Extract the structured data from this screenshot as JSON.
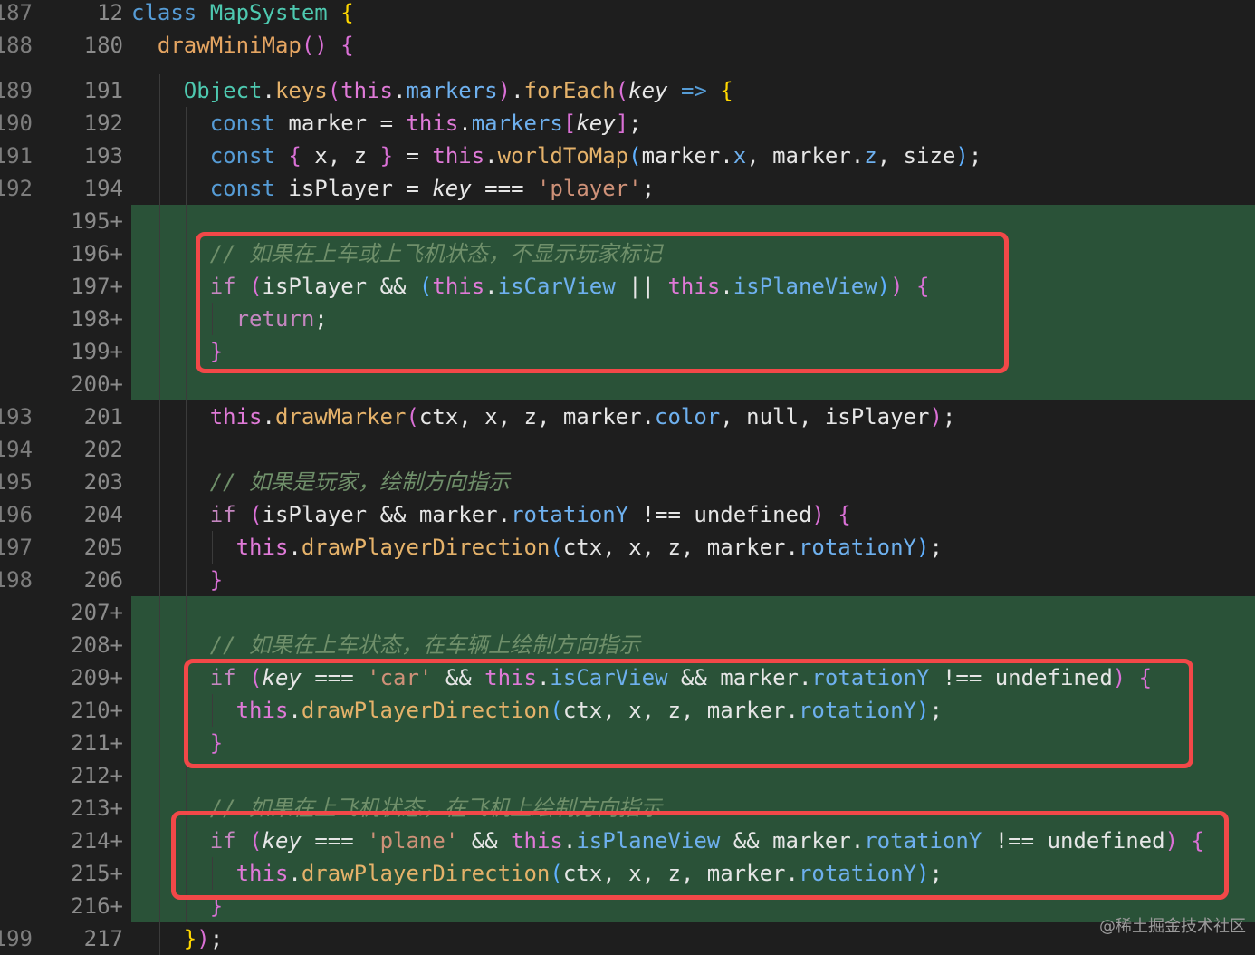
{
  "sticky": [
    {
      "old": "187",
      "new": "12",
      "tokens": [
        [
          "t-kw",
          "class "
        ],
        [
          "t-cls",
          "MapSystem"
        ],
        [
          "t-plain",
          " "
        ],
        [
          "t-brace",
          "{"
        ]
      ]
    },
    {
      "old": "188",
      "new": "180",
      "tokens": [
        [
          "t-fn",
          "  drawMiniMap"
        ],
        [
          "t-paren",
          "()"
        ],
        [
          "t-plain",
          " "
        ],
        [
          "t-paren",
          "{"
        ]
      ]
    }
  ],
  "lines": [
    {
      "old": "189",
      "new": "191",
      "added": false,
      "indent": 2,
      "tokens": [
        [
          "t-cls",
          "Object"
        ],
        [
          "t-plain",
          "."
        ],
        [
          "t-method",
          "keys"
        ],
        [
          "t-paren",
          "("
        ],
        [
          "t-thisk",
          "this"
        ],
        [
          "t-plain",
          "."
        ],
        [
          "t-prop",
          "markers"
        ],
        [
          "t-paren",
          ")"
        ],
        [
          "t-plain",
          "."
        ],
        [
          "t-method",
          "forEach"
        ],
        [
          "t-paren",
          "("
        ],
        [
          "t-param",
          "key"
        ],
        [
          "t-plain",
          " "
        ],
        [
          "t-kw",
          "=>"
        ],
        [
          "t-plain",
          " "
        ],
        [
          "t-brace",
          "{"
        ]
      ]
    },
    {
      "old": "190",
      "new": "192",
      "added": false,
      "indent": 3,
      "tokens": [
        [
          "t-kw",
          "const "
        ],
        [
          "t-var",
          "marker "
        ],
        [
          "t-op",
          "= "
        ],
        [
          "t-thisk",
          "this"
        ],
        [
          "t-plain",
          "."
        ],
        [
          "t-prop",
          "markers"
        ],
        [
          "t-paren",
          "["
        ],
        [
          "t-param",
          "key"
        ],
        [
          "t-paren",
          "]"
        ],
        [
          "t-plain",
          ";"
        ]
      ]
    },
    {
      "old": "191",
      "new": "193",
      "added": false,
      "indent": 3,
      "tokens": [
        [
          "t-kw",
          "const "
        ],
        [
          "t-paren",
          "{"
        ],
        [
          "t-var",
          " x, z "
        ],
        [
          "t-paren",
          "}"
        ],
        [
          "t-op",
          " = "
        ],
        [
          "t-thisk",
          "this"
        ],
        [
          "t-plain",
          "."
        ],
        [
          "t-method",
          "worldToMap"
        ],
        [
          "t-paren2",
          "("
        ],
        [
          "t-var",
          "marker."
        ],
        [
          "t-prop",
          "x"
        ],
        [
          "t-plain",
          ", "
        ],
        [
          "t-var",
          "marker."
        ],
        [
          "t-prop",
          "z"
        ],
        [
          "t-plain",
          ", size"
        ],
        [
          "t-paren2",
          ")"
        ],
        [
          "t-plain",
          ";"
        ]
      ]
    },
    {
      "old": "192",
      "new": "194",
      "added": false,
      "indent": 3,
      "tokens": [
        [
          "t-kw",
          "const "
        ],
        [
          "t-var",
          "isPlayer "
        ],
        [
          "t-op",
          "= "
        ],
        [
          "t-param",
          "key"
        ],
        [
          "t-op",
          " === "
        ],
        [
          "t-str",
          "'player'"
        ],
        [
          "t-plain",
          ";"
        ]
      ]
    },
    {
      "old": "",
      "new": "195+",
      "added": true,
      "indent": 3,
      "tokens": []
    },
    {
      "old": "",
      "new": "196+",
      "added": true,
      "indent": 3,
      "tokens": [
        [
          "t-cmt",
          "// 如果在上车或上飞机状态，不显示玩家标记"
        ]
      ]
    },
    {
      "old": "",
      "new": "197+",
      "added": true,
      "indent": 3,
      "tokens": [
        [
          "t-ctl",
          "if "
        ],
        [
          "t-paren",
          "("
        ],
        [
          "t-var",
          "isPlayer "
        ],
        [
          "t-op",
          "&& "
        ],
        [
          "t-paren2",
          "("
        ],
        [
          "t-thisk",
          "this"
        ],
        [
          "t-plain",
          "."
        ],
        [
          "t-prop",
          "isCarView"
        ],
        [
          "t-op",
          " || "
        ],
        [
          "t-thisk",
          "this"
        ],
        [
          "t-plain",
          "."
        ],
        [
          "t-prop",
          "isPlaneView"
        ],
        [
          "t-paren2",
          ")"
        ],
        [
          "t-paren",
          ")"
        ],
        [
          "t-plain",
          " "
        ],
        [
          "t-paren",
          "{"
        ]
      ]
    },
    {
      "old": "",
      "new": "198+",
      "added": true,
      "indent": 4,
      "tokens": [
        [
          "t-ctl",
          "return"
        ],
        [
          "t-plain",
          ";"
        ]
      ]
    },
    {
      "old": "",
      "new": "199+",
      "added": true,
      "indent": 3,
      "tokens": [
        [
          "t-paren",
          "}"
        ]
      ]
    },
    {
      "old": "",
      "new": "200+",
      "added": true,
      "indent": 3,
      "tokens": []
    },
    {
      "old": "193",
      "new": "201",
      "added": false,
      "indent": 3,
      "tokens": [
        [
          "t-thisk",
          "this"
        ],
        [
          "t-plain",
          "."
        ],
        [
          "t-method",
          "drawMarker"
        ],
        [
          "t-paren",
          "("
        ],
        [
          "t-var",
          "ctx, x, z, marker."
        ],
        [
          "t-prop",
          "color"
        ],
        [
          "t-plain",
          ", null, isPlayer"
        ],
        [
          "t-paren",
          ")"
        ],
        [
          "t-plain",
          ";"
        ]
      ]
    },
    {
      "old": "194",
      "new": "202",
      "added": false,
      "indent": 3,
      "tokens": []
    },
    {
      "old": "195",
      "new": "203",
      "added": false,
      "indent": 3,
      "tokens": [
        [
          "t-cmt",
          "// 如果是玩家，绘制方向指示"
        ]
      ]
    },
    {
      "old": "196",
      "new": "204",
      "added": false,
      "indent": 3,
      "tokens": [
        [
          "t-ctl",
          "if "
        ],
        [
          "t-paren",
          "("
        ],
        [
          "t-var",
          "isPlayer "
        ],
        [
          "t-op",
          "&& "
        ],
        [
          "t-var",
          "marker."
        ],
        [
          "t-prop",
          "rotationY"
        ],
        [
          "t-op",
          " !== "
        ],
        [
          "t-var",
          "undefined"
        ],
        [
          "t-paren",
          ")"
        ],
        [
          "t-plain",
          " "
        ],
        [
          "t-paren",
          "{"
        ]
      ]
    },
    {
      "old": "197",
      "new": "205",
      "added": false,
      "indent": 4,
      "tokens": [
        [
          "t-thisk",
          "this"
        ],
        [
          "t-plain",
          "."
        ],
        [
          "t-method",
          "drawPlayerDirection"
        ],
        [
          "t-paren2",
          "("
        ],
        [
          "t-var",
          "ctx, x, z, marker."
        ],
        [
          "t-prop",
          "rotationY"
        ],
        [
          "t-paren2",
          ")"
        ],
        [
          "t-plain",
          ";"
        ]
      ]
    },
    {
      "old": "198",
      "new": "206",
      "added": false,
      "indent": 3,
      "tokens": [
        [
          "t-paren",
          "}"
        ]
      ]
    },
    {
      "old": "",
      "new": "207+",
      "added": true,
      "indent": 3,
      "tokens": []
    },
    {
      "old": "",
      "new": "208+",
      "added": true,
      "indent": 3,
      "tokens": [
        [
          "t-cmt",
          "// 如果在上车状态，在车辆上绘制方向指示"
        ]
      ]
    },
    {
      "old": "",
      "new": "209+",
      "added": true,
      "indent": 3,
      "tokens": [
        [
          "t-ctl",
          "if "
        ],
        [
          "t-paren",
          "("
        ],
        [
          "t-param",
          "key"
        ],
        [
          "t-op",
          " === "
        ],
        [
          "t-str",
          "'car'"
        ],
        [
          "t-op",
          " && "
        ],
        [
          "t-thisk",
          "this"
        ],
        [
          "t-plain",
          "."
        ],
        [
          "t-prop",
          "isCarView"
        ],
        [
          "t-op",
          " && "
        ],
        [
          "t-var",
          "marker."
        ],
        [
          "t-prop",
          "rotationY"
        ],
        [
          "t-op",
          " !== "
        ],
        [
          "t-var",
          "undefined"
        ],
        [
          "t-paren",
          ")"
        ],
        [
          "t-plain",
          " "
        ],
        [
          "t-paren",
          "{"
        ]
      ]
    },
    {
      "old": "",
      "new": "210+",
      "added": true,
      "indent": 4,
      "tokens": [
        [
          "t-thisk",
          "this"
        ],
        [
          "t-plain",
          "."
        ],
        [
          "t-method",
          "drawPlayerDirection"
        ],
        [
          "t-paren2",
          "("
        ],
        [
          "t-var",
          "ctx, x, z, marker."
        ],
        [
          "t-prop",
          "rotationY"
        ],
        [
          "t-paren2",
          ")"
        ],
        [
          "t-plain",
          ";"
        ]
      ]
    },
    {
      "old": "",
      "new": "211+",
      "added": true,
      "indent": 3,
      "tokens": [
        [
          "t-paren",
          "}"
        ]
      ]
    },
    {
      "old": "",
      "new": "212+",
      "added": true,
      "indent": 3,
      "tokens": []
    },
    {
      "old": "",
      "new": "213+",
      "added": true,
      "indent": 3,
      "tokens": [
        [
          "t-cmt",
          "// 如果在上飞机状态，在飞机上绘制方向指示"
        ]
      ]
    },
    {
      "old": "",
      "new": "214+",
      "added": true,
      "indent": 3,
      "tokens": [
        [
          "t-ctl",
          "if "
        ],
        [
          "t-paren",
          "("
        ],
        [
          "t-param",
          "key"
        ],
        [
          "t-op",
          " === "
        ],
        [
          "t-str",
          "'plane'"
        ],
        [
          "t-op",
          " && "
        ],
        [
          "t-thisk",
          "this"
        ],
        [
          "t-plain",
          "."
        ],
        [
          "t-prop",
          "isPlaneView"
        ],
        [
          "t-op",
          " && "
        ],
        [
          "t-var",
          "marker."
        ],
        [
          "t-prop",
          "rotationY"
        ],
        [
          "t-op",
          " !== "
        ],
        [
          "t-var",
          "undefined"
        ],
        [
          "t-paren",
          ")"
        ],
        [
          "t-plain",
          " "
        ],
        [
          "t-paren",
          "{"
        ]
      ]
    },
    {
      "old": "",
      "new": "215+",
      "added": true,
      "indent": 4,
      "tokens": [
        [
          "t-thisk",
          "this"
        ],
        [
          "t-plain",
          "."
        ],
        [
          "t-method",
          "drawPlayerDirection"
        ],
        [
          "t-paren2",
          "("
        ],
        [
          "t-var",
          "ctx, x, z, marker."
        ],
        [
          "t-prop",
          "rotationY"
        ],
        [
          "t-paren2",
          ")"
        ],
        [
          "t-plain",
          ";"
        ]
      ]
    },
    {
      "old": "",
      "new": "216+",
      "added": true,
      "indent": 3,
      "tokens": [
        [
          "t-paren",
          "}"
        ]
      ]
    },
    {
      "old": "199",
      "new": "217",
      "added": false,
      "indent": 2,
      "tokens": [
        [
          "t-brace",
          "}"
        ],
        [
          "t-paren",
          ")"
        ],
        [
          "t-plain",
          ";"
        ]
      ]
    }
  ],
  "watermark": "@稀土掘金技术社区",
  "colors": {
    "added_bg": "#2a5238",
    "editor_bg": "#1e1e1e",
    "highlight_border": "#f24848"
  }
}
